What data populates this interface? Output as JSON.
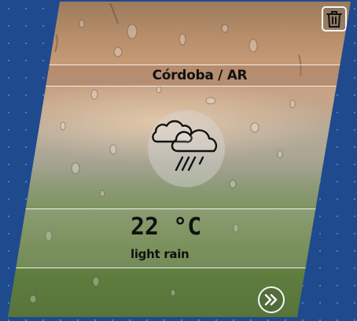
{
  "location": {
    "city_label": "Córdoba / AR"
  },
  "weather": {
    "temperature": "22 °C",
    "description": "light rain",
    "icon": "cloud-rain-icon"
  },
  "actions": {
    "delete_icon": "trash-icon",
    "more_icon": "double-chevron-right-icon"
  },
  "colors": {
    "page_background": "#1f4a8e",
    "text": "#111111",
    "divider": "#ffffff"
  }
}
